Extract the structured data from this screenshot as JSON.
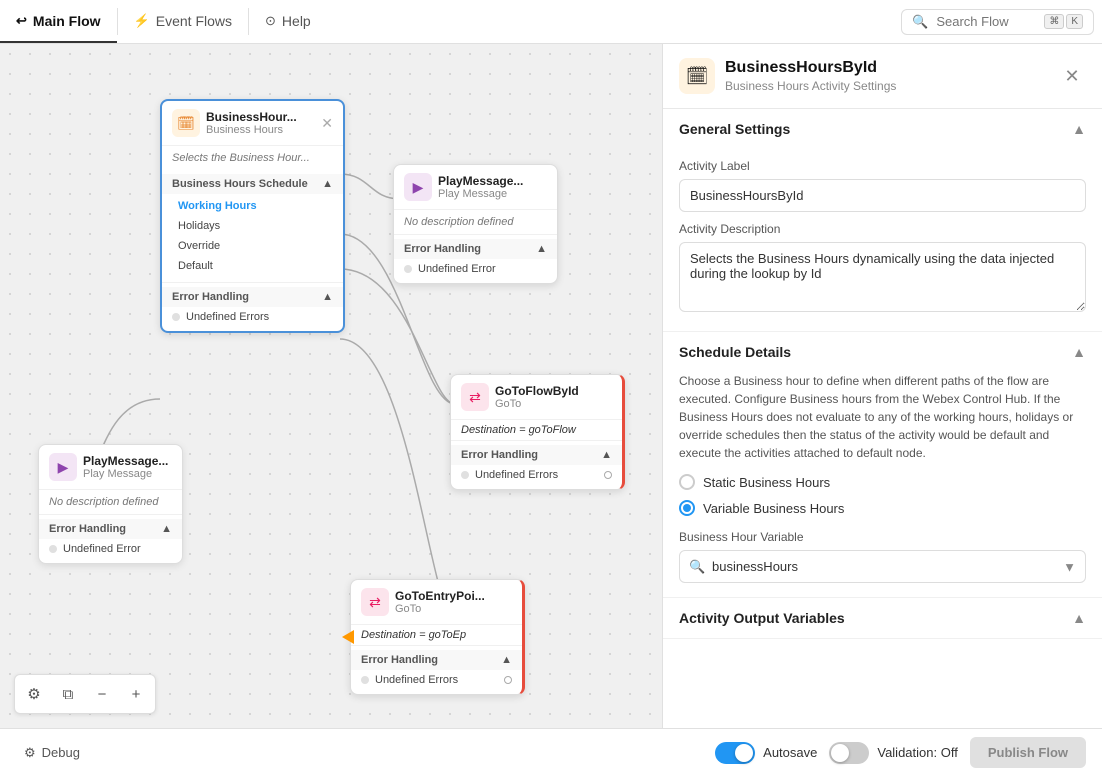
{
  "nav": {
    "main_flow_label": "Main Flow",
    "event_flows_label": "Event Flows",
    "help_label": "Help",
    "search_placeholder": "Search Flow",
    "kbd1": "⌘",
    "kbd2": "K"
  },
  "canvas": {
    "business_hours_node": {
      "title": "BusinessHour...",
      "subtitle": "Business Hours",
      "desc": "Selects the Business Hour...",
      "schedule_section_label": "Business Hours Schedule",
      "items": [
        {
          "label": "Working Hours",
          "active": true
        },
        {
          "label": "Holidays",
          "active": false
        },
        {
          "label": "Override",
          "active": false
        },
        {
          "label": "Default",
          "active": false
        }
      ],
      "error_section_label": "Error Handling",
      "error_item": "Undefined Errors"
    },
    "play_message_top": {
      "title": "PlayMessage...",
      "subtitle": "Play Message",
      "desc": "No description defined",
      "error_section_label": "Error Handling",
      "error_item": "Undefined Error"
    },
    "goto_flow_by_id": {
      "title": "GoToFlowById",
      "subtitle": "GoTo",
      "dest_label": "Destination = goToFlow",
      "error_section_label": "Error Handling",
      "error_item": "Undefined Errors"
    },
    "goto_entry_point": {
      "title": "GoToEntryPoi...",
      "subtitle": "GoTo",
      "dest_label": "Destination = goToEp",
      "error_section_label": "Error Handling",
      "error_item": "Undefined Errors"
    },
    "play_message_left": {
      "title": "PlayMessage...",
      "subtitle": "Play Message",
      "desc": "No description defined",
      "error_section_label": "Error Handling",
      "error_item": "Undefined Error"
    }
  },
  "right_panel": {
    "icon": "🗓",
    "title": "BusinessHoursById",
    "subtitle": "Business Hours Activity Settings",
    "general_settings": {
      "section_label": "General Settings",
      "activity_label_field": "Activity Label",
      "activity_label_value": "BusinessHoursById",
      "activity_desc_field": "Activity Description",
      "activity_desc_value": "Selects the Business Hours dynamically using the data injected during the lookup by Id"
    },
    "schedule_details": {
      "section_label": "Schedule Details",
      "description": "Choose a Business hour to define when different paths of the flow are executed. Configure Business hours from the Webex Control Hub. If the Business Hours does not evaluate to any of the working hours, holidays or override schedules then the status of the activity would be default and execute the activities attached to default node.",
      "radio_static_label": "Static Business Hours",
      "radio_variable_label": "Variable Business Hours",
      "selected_radio": "variable",
      "bh_variable_label": "Business Hour Variable",
      "bh_variable_value": "businessHours"
    },
    "activity_output": {
      "section_label": "Activity Output Variables"
    }
  },
  "bottom_bar": {
    "debug_label": "Debug",
    "autosave_label": "Autosave",
    "autosave_on": true,
    "validation_label": "Validation: Off",
    "validation_on": false,
    "publish_label": "Publish Flow"
  },
  "canvas_toolbar": {
    "settings_icon": "⚙",
    "copy_icon": "⧉",
    "zoom_out_icon": "−",
    "zoom_in_icon": "+"
  }
}
